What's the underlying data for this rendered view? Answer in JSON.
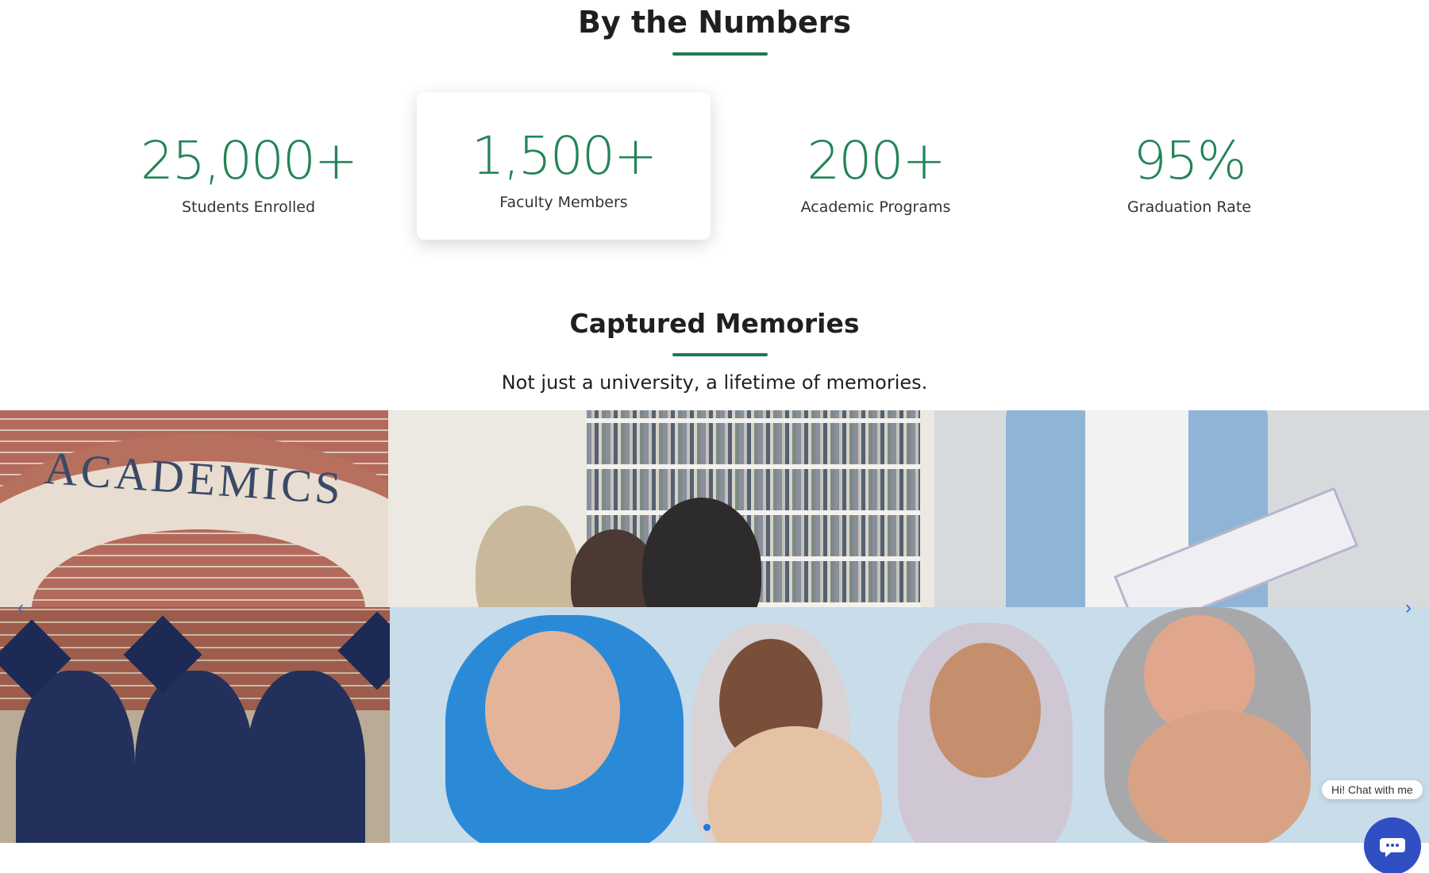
{
  "numbers_section": {
    "title": "By the Numbers",
    "stats": [
      {
        "value": "25,000+",
        "label": "Students Enrolled"
      },
      {
        "value": "1,500+",
        "label": "Faculty Members"
      },
      {
        "value": "200+",
        "label": "Academic Programs"
      },
      {
        "value": "95%",
        "label": "Graduation Rate"
      }
    ]
  },
  "memories_section": {
    "title": "Captured Memories",
    "tagline": "Not just a university, a lifetime of memories.",
    "gallery": {
      "academics_sign": "ACADEMICS"
    }
  },
  "chat": {
    "label": "Hi! Chat with me"
  },
  "colors": {
    "accent_green": "#238457",
    "chat_blue": "#2f4fc2"
  }
}
